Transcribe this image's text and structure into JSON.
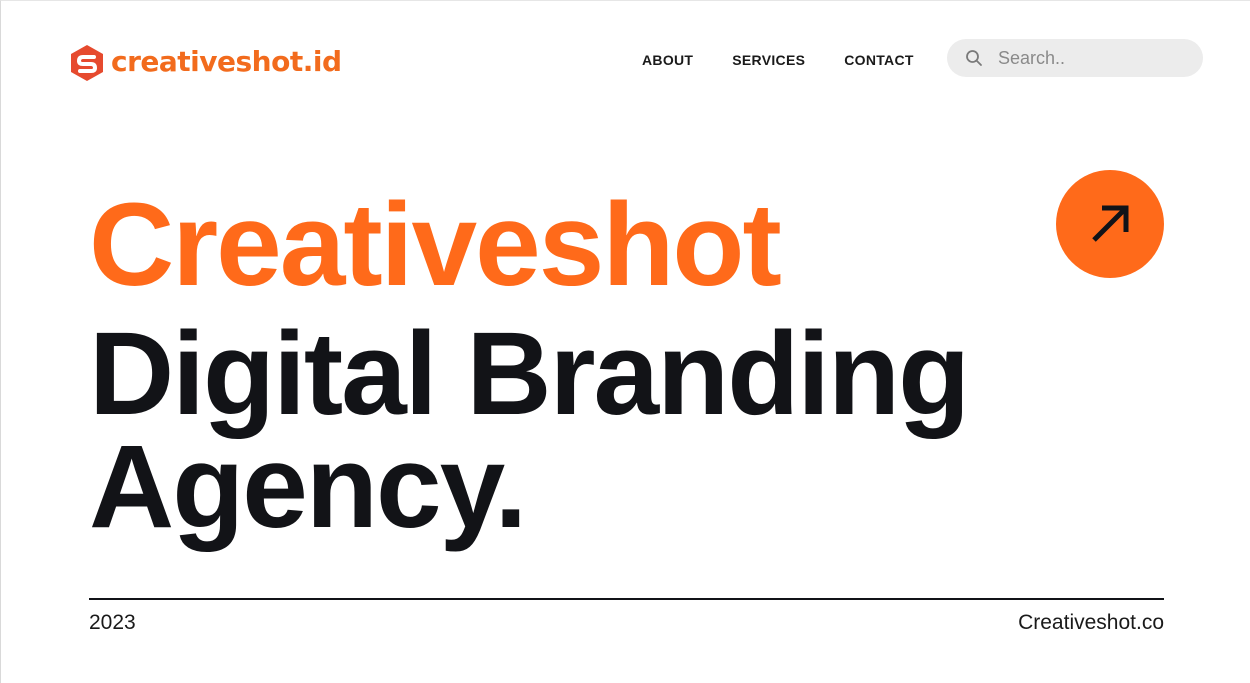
{
  "brand": {
    "name": "creativeshot.id",
    "logo_icon": "creativeshot-logo-icon",
    "accent_color": "#ff6a1a"
  },
  "nav": {
    "items": [
      {
        "label": "ABOUT"
      },
      {
        "label": "SERVICES"
      },
      {
        "label": "CONTACT"
      }
    ]
  },
  "search": {
    "placeholder": "Search..",
    "value": "",
    "icon": "search-icon"
  },
  "hero": {
    "line1": "Creativeshot",
    "line2": "Digital Branding",
    "line3": "Agency.",
    "action_icon": "arrow-up-right-icon"
  },
  "footer": {
    "year": "2023",
    "site": "Creativeshot.co"
  },
  "colors": {
    "accent": "#ff6a1a",
    "text": "#121317",
    "search_bg": "#ececec"
  }
}
